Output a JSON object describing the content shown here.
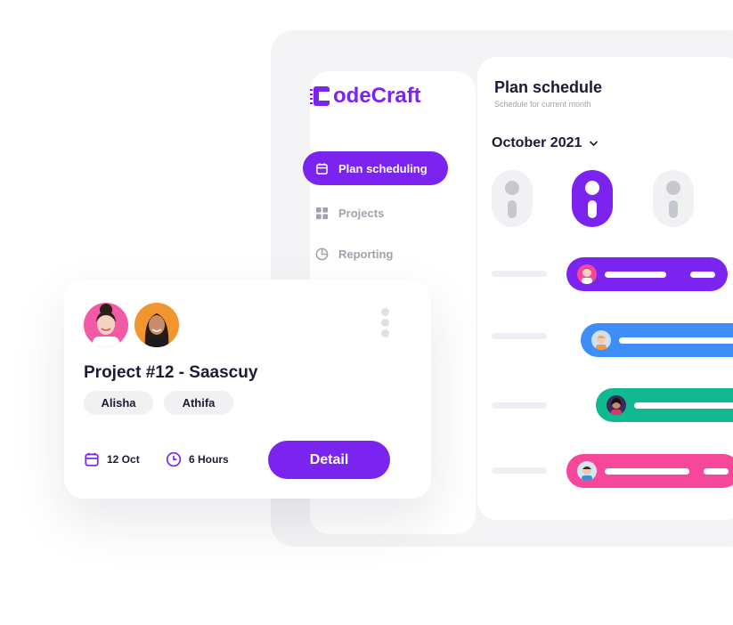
{
  "brand": {
    "logo_text": "odeCraft",
    "accent": "#7b24f0"
  },
  "sidebar": {
    "items": [
      {
        "label": "Plan scheduling",
        "icon": "calendar-icon",
        "active": true
      },
      {
        "label": "Projects",
        "icon": "grid-icon",
        "active": false
      },
      {
        "label": "Reporting",
        "icon": "pie-chart-icon",
        "active": false
      }
    ]
  },
  "main": {
    "title": "Plan schedule",
    "subtitle": "Schedule for current month",
    "month": "October 2021",
    "schedule_colors": [
      "#7b24f0",
      "#3e8ef7",
      "#10b98f",
      "#f7479b"
    ]
  },
  "card": {
    "project_title": "Project #12 - Saascuy",
    "members": [
      "Alisha",
      "Athifa"
    ],
    "date": "12 Oct",
    "duration": "6 Hours",
    "detail_label": "Detail"
  }
}
